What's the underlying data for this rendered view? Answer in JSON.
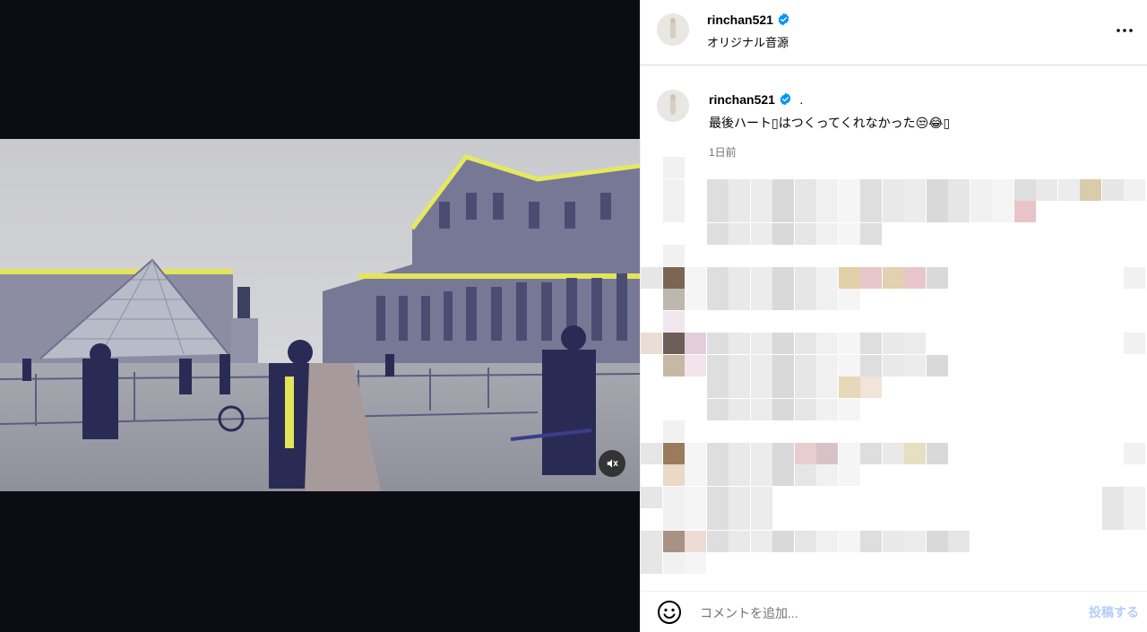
{
  "post": {
    "username": "rinchan521",
    "audio": "オリジナル音源",
    "caption_username": "rinchan521",
    "caption_dot": ".",
    "caption_text": "最後ハート▯はつくってくれなかった😒😂▯",
    "time": "1日前"
  },
  "video": {
    "muted": true,
    "icon": "volume-muted-icon"
  },
  "footer": {
    "comment_placeholder": "コメントを追加...",
    "post_label": "投稿する"
  },
  "colors": {
    "verified": "#0095f6",
    "post_disabled": "#b3cdfb",
    "media_bg": "#0b0d12"
  }
}
